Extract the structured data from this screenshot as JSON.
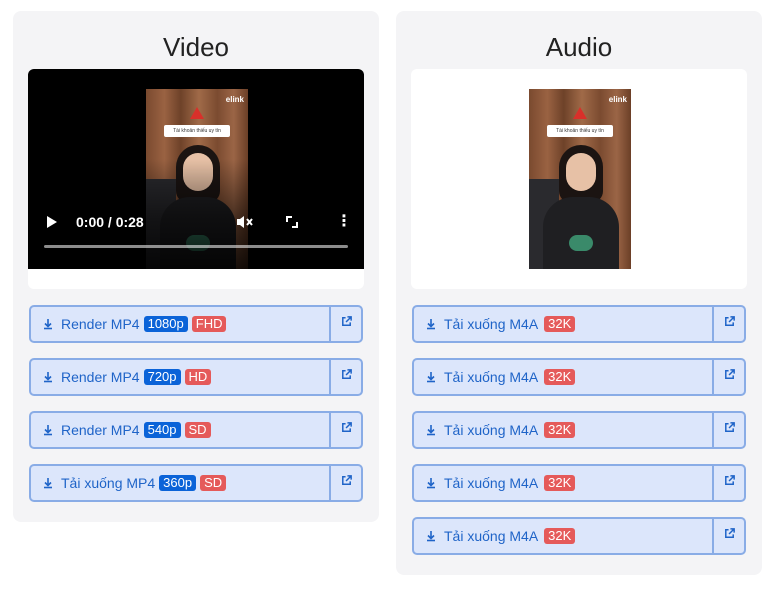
{
  "video_panel": {
    "title": "Video",
    "player": {
      "time": "0:00 / 0:28",
      "progress": 0.0,
      "thumb_logo": "elink",
      "thumb_sign": "Tài khoản thiếu uy tín"
    },
    "buttons": [
      {
        "label": "Render MP4",
        "resolution": "1080p",
        "quality": "FHD"
      },
      {
        "label": "Render MP4",
        "resolution": "720p",
        "quality": "HD"
      },
      {
        "label": "Render MP4",
        "resolution": "540p",
        "quality": "SD"
      },
      {
        "label": "Tải xuống MP4",
        "resolution": "360p",
        "quality": "SD"
      }
    ]
  },
  "audio_panel": {
    "title": "Audio",
    "thumb_logo": "elink",
    "thumb_sign": "Tài khoản thiếu uy tín",
    "buttons": [
      {
        "label": "Tải xuống M4A",
        "bitrate": "32K"
      },
      {
        "label": "Tải xuống M4A",
        "bitrate": "32K"
      },
      {
        "label": "Tải xuống M4A",
        "bitrate": "32K"
      },
      {
        "label": "Tải xuống M4A",
        "bitrate": "32K"
      },
      {
        "label": "Tải xuống M4A",
        "bitrate": "32K"
      }
    ]
  },
  "icons": {
    "download": "download-icon",
    "external": "external-link-icon",
    "play": "play-icon",
    "mute": "volume-muted-icon",
    "fullscreen": "fullscreen-icon",
    "more": "more-vertical-icon"
  },
  "colors": {
    "button_bg": "#dce6fb",
    "button_border": "#89ace6",
    "button_text": "#1f64c8",
    "badge_resolution": "#0b63d8",
    "badge_quality": "#e55a5a"
  }
}
